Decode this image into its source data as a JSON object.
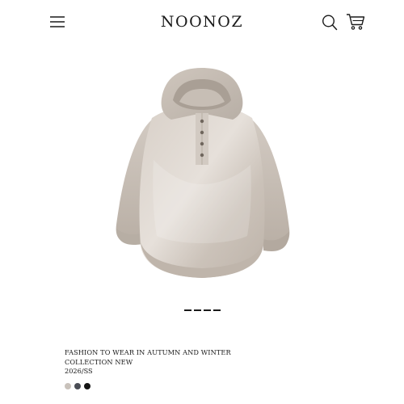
{
  "header": {
    "brand": "NOONOZ",
    "icons": [
      "menu-icon",
      "search-icon",
      "cart-icon"
    ]
  },
  "carousel": {
    "slides": 4
  },
  "product": {
    "title_line1": "FASHION TO WEAR IN AUTUMN AND WINTER",
    "title_line2": "COLLECTION NEW",
    "season": "2026/SS",
    "swatches": [
      {
        "name": "beige-grey",
        "color": "#c9c2bb"
      },
      {
        "name": "charcoal",
        "color": "#4a4d55"
      },
      {
        "name": "black",
        "color": "#141414"
      }
    ]
  },
  "colors": {
    "text": "#1a1a1a",
    "background": "#ffffff",
    "garment": "#cfc6bd"
  }
}
